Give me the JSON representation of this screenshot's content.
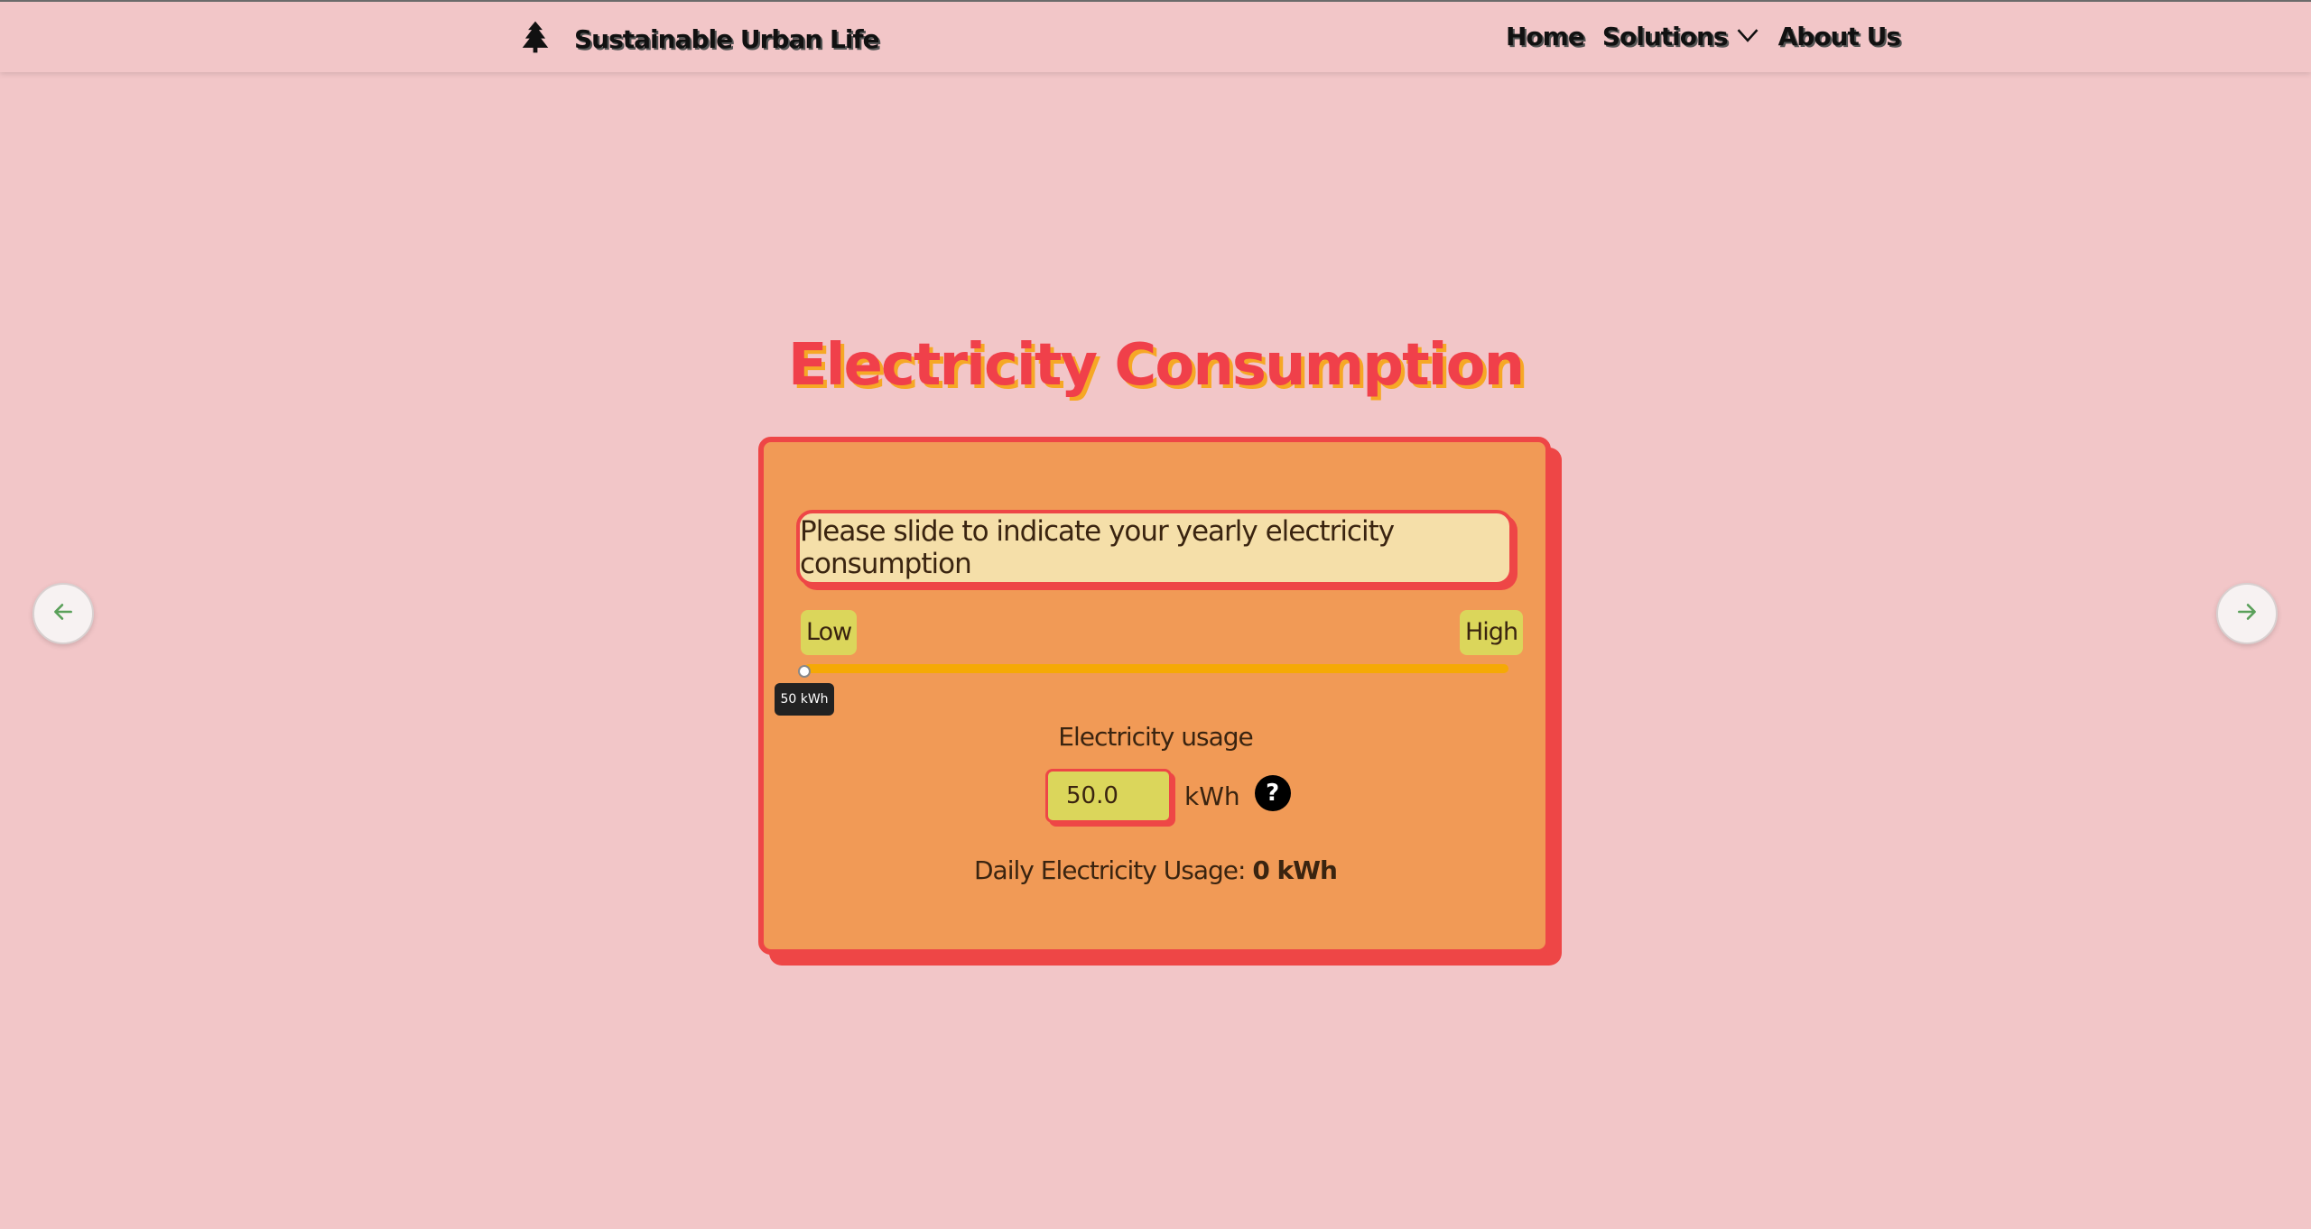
{
  "nav": {
    "brand_icon": "tree-icon",
    "brand_name": "Sustainable Urban Life",
    "links": [
      "Home",
      "Solutions",
      "About Us"
    ],
    "dropdown_icon": "chevron-down-icon"
  },
  "page": {
    "title": "Electricity Consumption",
    "prompt": "Please slide to indicate your yearly electricity consumption",
    "slider": {
      "low_label": "Low",
      "high_label": "High",
      "tooltip": "50 kWh",
      "value_fraction": 0.0
    },
    "usage_label": "Electricity usage",
    "usage_value": "50.0",
    "usage_unit": "kWh",
    "help_glyph": "?",
    "daily_label": "Daily Electricity Usage:",
    "daily_value": "0 kWh"
  },
  "controls": {
    "prev_icon": "arrow-left-icon",
    "next_icon": "arrow-right-icon"
  },
  "colors": {
    "background": "#f2c6c8",
    "card": "#f19a56",
    "card_border": "#ee4646",
    "title": "#f0404a",
    "title_shadow": "#f6a825",
    "track": "#f5a905",
    "pill": "#dbd65b",
    "prompt_bg": "#f5dfa9"
  }
}
